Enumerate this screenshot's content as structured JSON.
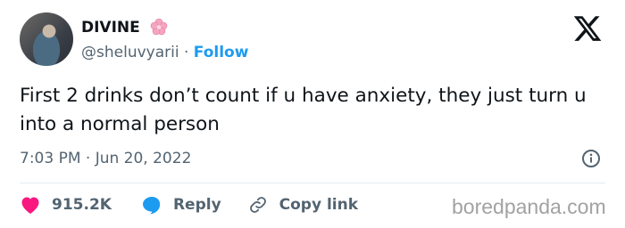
{
  "tweet": {
    "display_name": "DIVINE",
    "handle": "@sheluvyarii",
    "separator": "·",
    "follow_label": "Follow",
    "text": "First 2 drinks don’t count if u have anxiety, they just turn u into a normal person",
    "timestamp": "7:03 PM · Jun 20, 2022"
  },
  "actions": {
    "likes": "915.2K",
    "reply": "Reply",
    "copy_link": "Copy link"
  },
  "watermark": "boredpanda.com",
  "icons": {
    "platform": "x-logo-icon",
    "verified_emoji": "cherry-blossom-icon",
    "info": "info-icon",
    "like": "heart-icon",
    "reply": "speech-bubble-icon",
    "copy": "link-icon"
  },
  "colors": {
    "link": "#1d9bf0",
    "heart": "#f91880",
    "secondary_text": "#536471",
    "primary_text": "#0f1419"
  }
}
